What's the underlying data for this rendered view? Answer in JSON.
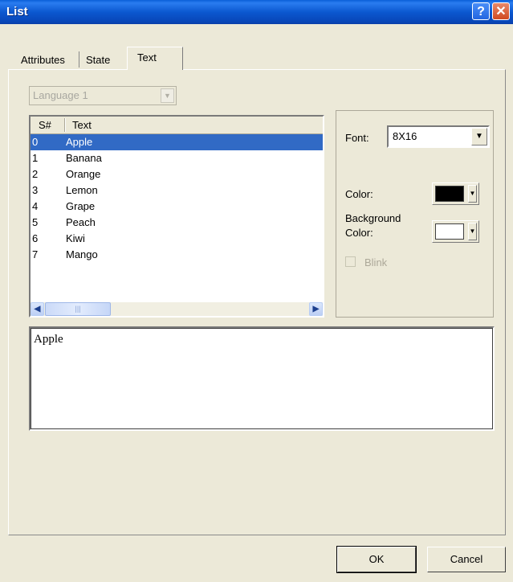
{
  "window": {
    "title": "List",
    "help_label": "?",
    "close_label": "✕"
  },
  "tabs": [
    {
      "label": "Attributes",
      "active": false
    },
    {
      "label": "State",
      "active": false
    },
    {
      "label": "Text",
      "active": true
    }
  ],
  "language_select": {
    "value": "Language 1",
    "enabled": false
  },
  "list": {
    "columns": [
      "S#",
      "Text"
    ],
    "rows": [
      {
        "sn": "0",
        "text": "Apple",
        "selected": true
      },
      {
        "sn": "1",
        "text": "Banana"
      },
      {
        "sn": "2",
        "text": "Orange"
      },
      {
        "sn": "3",
        "text": "Lemon"
      },
      {
        "sn": "4",
        "text": "Grape"
      },
      {
        "sn": "5",
        "text": "Peach"
      },
      {
        "sn": "6",
        "text": "Kiwi"
      },
      {
        "sn": "7",
        "text": "Mango"
      }
    ]
  },
  "font": {
    "label": "Font:",
    "value": "8X16"
  },
  "color": {
    "label": "Color:",
    "value": "#000000"
  },
  "background_color": {
    "label_line1": "Background",
    "label_line2": "Color:",
    "value": "#ffffff"
  },
  "blink": {
    "label": "Blink",
    "checked": false,
    "enabled": false
  },
  "text_editor": {
    "value": "Apple"
  },
  "buttons": {
    "ok": "OK",
    "cancel": "Cancel"
  },
  "colors": {
    "titlebar": "#0b58d0",
    "selection": "#316ac5",
    "dialog_bg": "#ece9d8"
  }
}
